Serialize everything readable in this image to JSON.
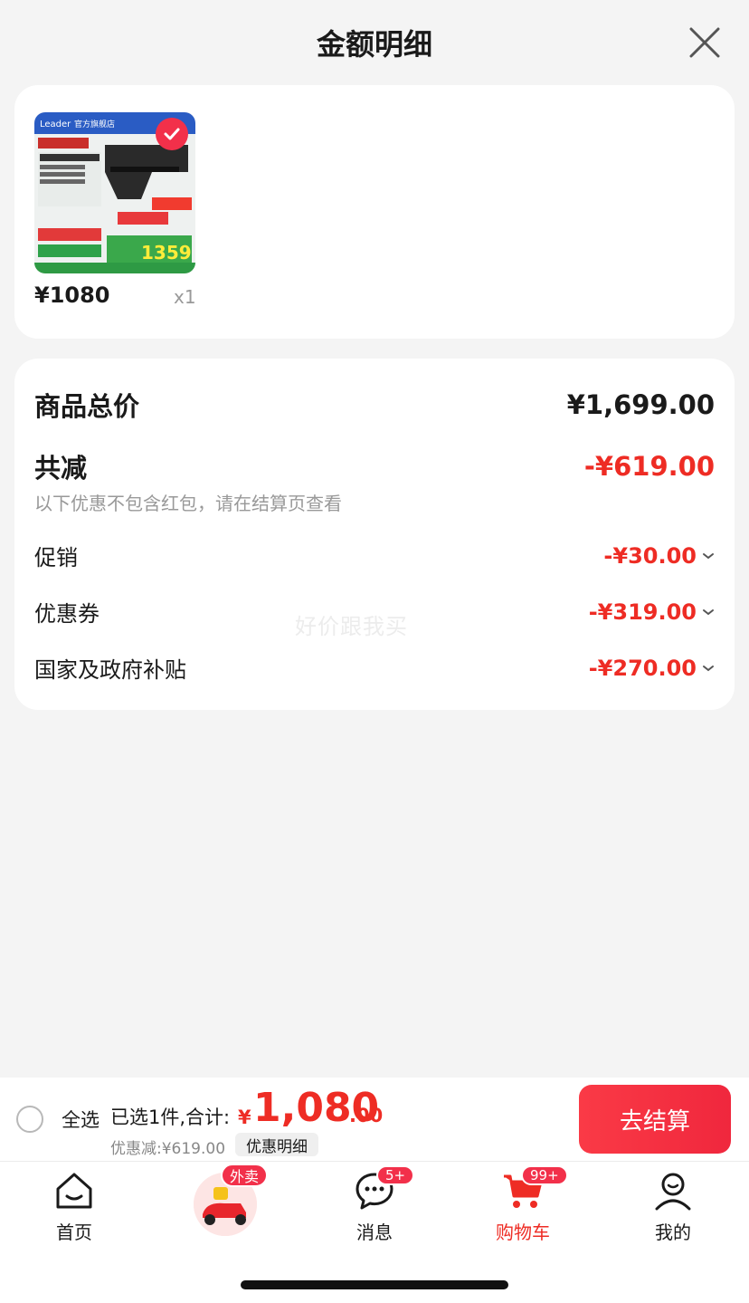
{
  "header": {
    "title": "金额明细"
  },
  "product": {
    "price": "¥1080",
    "quantity": "x1",
    "image_brand": "Leader",
    "image_store": "官方旗舰店",
    "image_price": "1359"
  },
  "summary": {
    "total_label": "商品总价",
    "total_value": "¥1,699.00",
    "reduction_label": "共减",
    "reduction_value": "-¥619.00",
    "note": "以下优惠不包含红包，请在结算页查看",
    "items": [
      {
        "label": "促销",
        "value": "-¥30.00"
      },
      {
        "label": "优惠券",
        "value": "-¥319.00"
      },
      {
        "label": "国家及政府补贴",
        "value": "-¥270.00"
      }
    ],
    "watermark": "好价跟我买"
  },
  "checkout": {
    "select_all": "全选",
    "selected_count": "已选1件,合计:",
    "currency": "¥",
    "total_main": "1,080",
    "total_decimal": ".00",
    "discount_text": "优惠减:¥619.00",
    "discount_detail": "优惠明细",
    "checkout_button": "去结算"
  },
  "tabbar": {
    "tabs": [
      {
        "label": "首页",
        "icon": "home-icon"
      },
      {
        "label": "外卖",
        "icon": "scooter-icon",
        "badge": "外卖"
      },
      {
        "label": "消息",
        "icon": "message-icon",
        "badge": "5+"
      },
      {
        "label": "购物车",
        "icon": "cart-icon",
        "badge": "99+"
      },
      {
        "label": "我的",
        "icon": "profile-icon"
      }
    ]
  },
  "colors": {
    "accent": "#ee2c24",
    "checkout_button": "#f2304a",
    "background": "#f4f4f4"
  }
}
